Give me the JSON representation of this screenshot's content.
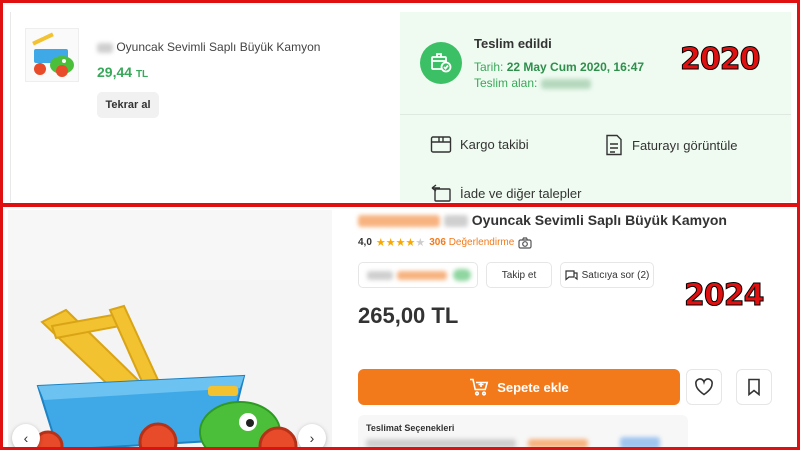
{
  "order_2020": {
    "year_badge": "2020",
    "product": {
      "name": "Oyuncak Sevimli Saplı Büyük Kamyon",
      "price_value": "29,44",
      "price_currency": "TL"
    },
    "reorder_label": "Tekrar al",
    "delivery": {
      "status": "Teslim edildi",
      "date_label": "Tarih:",
      "date_value": "22 May Cum 2020, 16:47",
      "receiver_label": "Teslim alan:"
    },
    "actions": [
      {
        "label": "Kargo takibi",
        "icon": "box-icon"
      },
      {
        "label": "Faturayı görüntüle",
        "icon": "document-icon"
      },
      {
        "label": "İade ve diğer talepler",
        "icon": "return-box-icon"
      }
    ]
  },
  "product_2024": {
    "year_badge": "2024",
    "name": "Oyuncak Sevimli Saplı Büyük Kamyon",
    "rating": "4,0",
    "rating_stars": 4,
    "review_count": "306",
    "review_label": "Değerlendirme",
    "follow_label": "Takip et",
    "ask_seller_label": "Satıcıya sor (2)",
    "price": "265,00 TL",
    "add_to_cart_label": "Sepete ekle",
    "delivery_options_title": "Teslimat Seçenekleri"
  },
  "colors": {
    "frame_red": "#e01010",
    "accent_orange": "#f27a1a",
    "delivered_green": "#3cc065",
    "price_green": "#39a85a"
  }
}
